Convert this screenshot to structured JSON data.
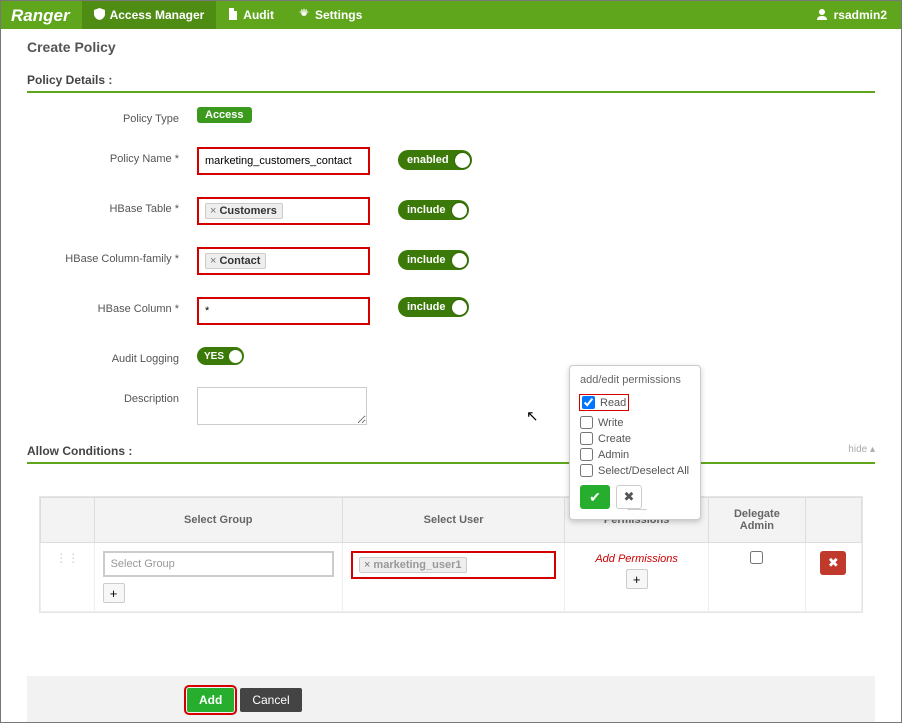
{
  "brand": "Ranger",
  "nav": {
    "access": "Access Manager",
    "audit": "Audit",
    "settings": "Settings"
  },
  "user": "rsadmin2",
  "page_title": "Create Policy",
  "sections": {
    "details_title": "Policy Details :",
    "allow_title": "Allow Conditions :",
    "hide": "hide"
  },
  "labels": {
    "policy_type": "Policy Type",
    "policy_name": "Policy Name *",
    "hbase_table": "HBase Table *",
    "hbase_cf": "HBase Column-family *",
    "hbase_col": "HBase Column *",
    "audit": "Audit Logging",
    "description": "Description"
  },
  "values": {
    "access_badge": "Access",
    "policy_name": "marketing_customers_contact",
    "hbase_table_tag": "Customers",
    "hbase_cf_tag": "Contact",
    "hbase_col": "*"
  },
  "toggles": {
    "enabled": "enabled",
    "include1": "include",
    "include2": "include",
    "include3": "include",
    "yes": "YES"
  },
  "cond": {
    "headers": {
      "group": "Select Group",
      "user": "Select User",
      "perm": "Permissions",
      "delegate": "Delegate Admin"
    },
    "row": {
      "group_placeholder": "Select Group",
      "user_tag": "marketing_user1",
      "add_perm": "Add Permissions"
    }
  },
  "permissions_popover": {
    "title": "add/edit permissions",
    "opts": {
      "read": "Read",
      "write": "Write",
      "create": "Create",
      "admin": "Admin",
      "all": "Select/Deselect All"
    }
  },
  "buttons": {
    "add": "Add",
    "cancel": "Cancel",
    "plus": "+",
    "check": "✔",
    "x": "✖",
    "tag_x": "×"
  }
}
